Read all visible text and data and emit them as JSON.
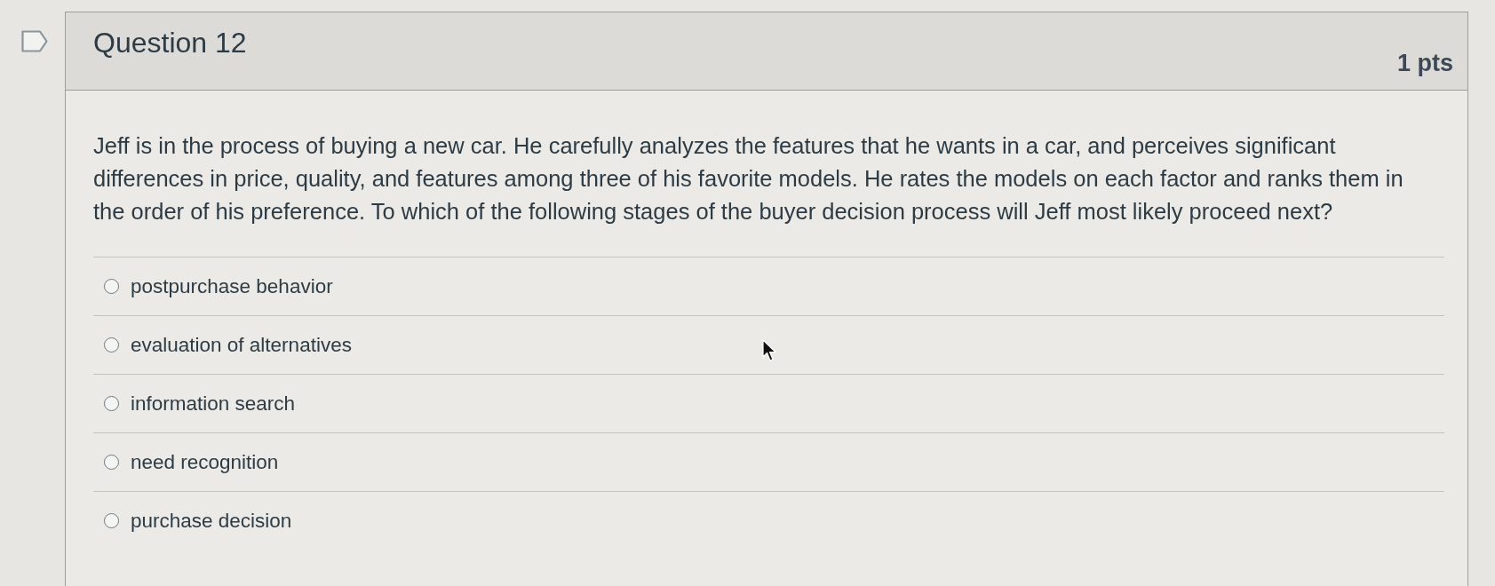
{
  "question": {
    "title": "Question 12",
    "points": "1 pts",
    "text": "Jeff is in the process of buying a new car. He carefully analyzes the features that he wants in a car, and perceives significant differences in price, quality, and features among three of his favorite models. He rates the models on each factor and ranks them in the order of his preference. To which of the following stages of the buyer decision process will Jeff most likely proceed next?",
    "answers": [
      {
        "label": "postpurchase behavior",
        "selected": false
      },
      {
        "label": "evaluation of alternatives",
        "selected": false
      },
      {
        "label": "information search",
        "selected": false
      },
      {
        "label": "need recognition",
        "selected": false
      },
      {
        "label": "purchase decision",
        "selected": false
      }
    ]
  }
}
